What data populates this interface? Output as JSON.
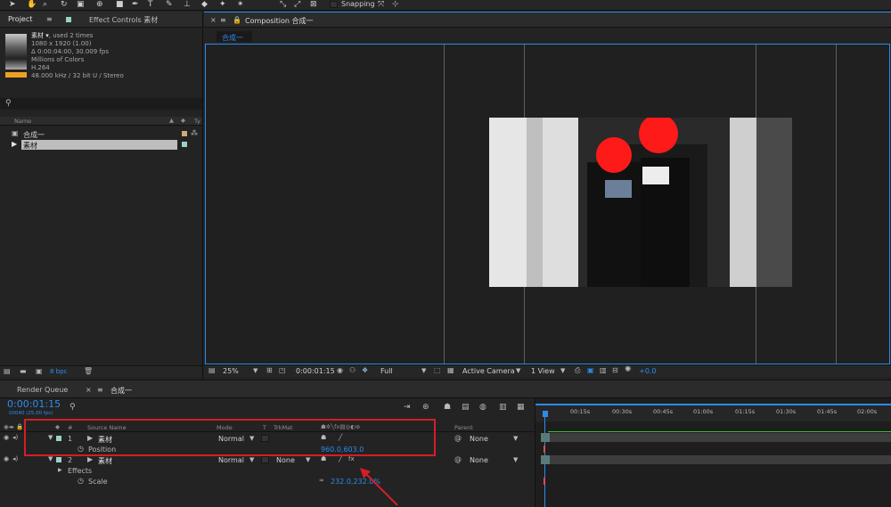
{
  "toolbar": {
    "snapping_label": "Snapping",
    "icons": [
      "selection-tool",
      "hand-tool",
      "zoom-tool",
      "rotation-tool",
      "camera-tool",
      "pan-behind-tool",
      "shape-tool",
      "pen-tool",
      "type-tool",
      "brush-tool",
      "clone-stamp-tool",
      "eraser-tool",
      "roto-brush-tool",
      "puppet-tool"
    ]
  },
  "project_panel": {
    "tab_project": "Project",
    "tab_effect_controls": "Effect Controls 素材",
    "source_name": "素材 ▾",
    "used": ", used 2 times",
    "dimensions": "1080 x 1920 (1.00)",
    "duration": "Δ 0:00:04:00, 30.009 fps",
    "colors": "Millions of Colors",
    "codec": "H.264",
    "audio": "48.000 kHz / 32 bit U / Stereo",
    "search_placeholder": "",
    "col_name": "Name",
    "col_type": "Ty",
    "items": [
      {
        "name": "合成一",
        "icon": "composition-icon"
      },
      {
        "name": "素材",
        "icon": "footage-icon"
      }
    ],
    "bpc": "8 bpc"
  },
  "composition_panel": {
    "tab": "Composition 合成一",
    "flow_label": "合成一",
    "zoom": "25%",
    "timecode": "0:00:01:15",
    "resolution": "Full",
    "camera": "Active Camera",
    "views": "1 View",
    "exposure": "+0.0"
  },
  "timeline": {
    "tab_render_queue": "Render Queue",
    "tab_comp": "合成一",
    "current_time": "0:00:01:15",
    "frame_info": "00040 (25.00 fps)",
    "col_source": "Source Name",
    "col_mode": "Mode",
    "col_t": "T",
    "col_trkmat": "TrkMat",
    "col_parent": "Parent",
    "col_num": "#",
    "ruler": [
      "00:15s",
      "00:30s",
      "00:45s",
      "01:00s",
      "01:15s",
      "01:30s",
      "01:45s",
      "02:00s"
    ],
    "layers": [
      {
        "num": "1",
        "name": "素材",
        "mode": "Normal",
        "trkmat": "",
        "parent": "None"
      },
      {
        "num": "2",
        "name": "素材",
        "mode": "Normal",
        "trkmat": "None",
        "parent": "None"
      }
    ],
    "position_label": "Position",
    "position_value": "960.0,603.0",
    "effects_label": "Effects",
    "scale_label": "Scale",
    "scale_value": "232.0,232.0%"
  },
  "colors": {
    "accent_blue": "#2d8ceb",
    "annotation_red": "#d41e27",
    "label_aqua": "#9ad2c8"
  }
}
